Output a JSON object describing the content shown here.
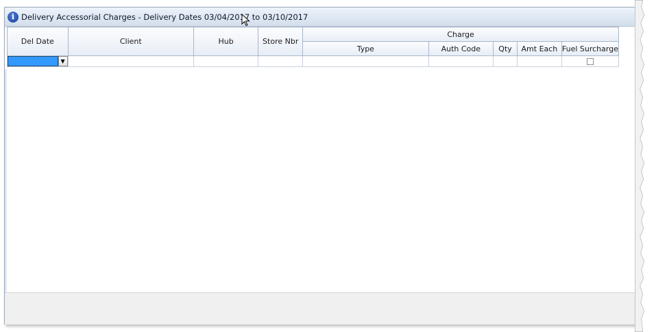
{
  "window": {
    "title": "Delivery Accessorial Charges - Delivery Dates 03/04/2017 to 03/10/2017",
    "title_icon": "info-icon"
  },
  "grid": {
    "columns": {
      "del_date": "Del Date",
      "client": "Client",
      "hub": "Hub",
      "store_nbr": "Store Nbr",
      "charge_group": "Charge",
      "type": "Type",
      "auth_code": "Auth Code",
      "qty": "Qty",
      "amt_each": "Amt Each",
      "fuel_surcharge": "Fuel Surcharge"
    },
    "new_row": {
      "del_date": "",
      "client": "",
      "hub": "",
      "store_nbr": "",
      "type": "",
      "auth_code": "",
      "qty": "",
      "amt_each": "",
      "fuel_surcharge": false
    }
  },
  "colors": {
    "selection": "#3399ff",
    "header_border": "#a9b6c8",
    "status_band": "#f0f0f0"
  }
}
